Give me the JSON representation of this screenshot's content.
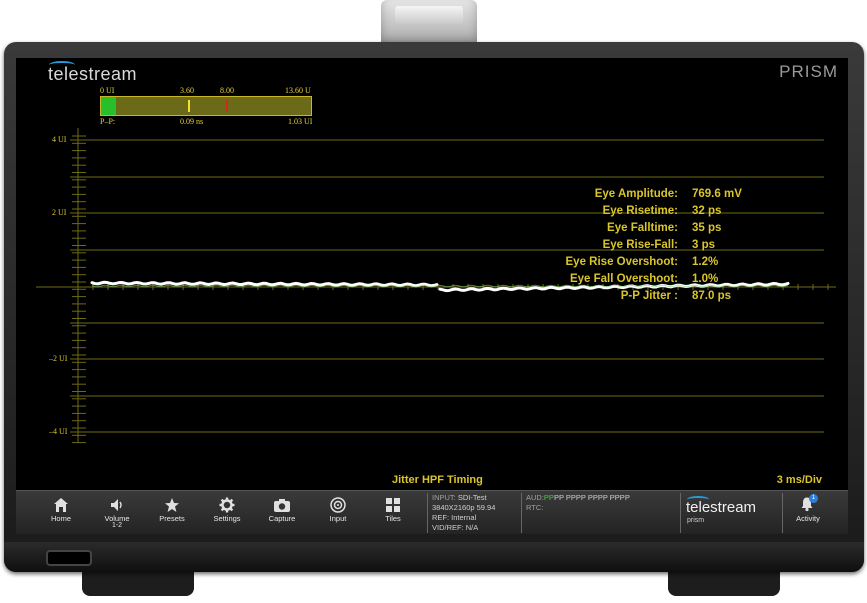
{
  "device": {
    "brand": "telestream",
    "model_title": "PRISM"
  },
  "meter": {
    "top_labels": [
      "0 UI",
      "3.60",
      "8.00",
      "13.60 U"
    ],
    "bottom_left": "P–P:",
    "bottom_mid": "0.09 ns",
    "bottom_right": "1.03 UI",
    "fill_fraction": 0.07,
    "colors": {
      "fill": "#27c02b",
      "bar": "#6b6a18",
      "marker_yellow": "#f4e22a",
      "marker_red": "#d12a1a"
    }
  },
  "y_axis_labels": [
    "4 UI",
    "2 UI",
    "–2 UI",
    "–4 UI"
  ],
  "measurements": [
    {
      "key": "Eye Amplitude:",
      "value": "769.6 mV"
    },
    {
      "key": "Eye Risetime:",
      "value": "32 ps"
    },
    {
      "key": "Eye Falltime:",
      "value": "35 ps"
    },
    {
      "key": "Eye Rise-Fall:",
      "value": "3 ps"
    },
    {
      "key": "Eye Rise Overshoot:",
      "value": "1.2%"
    },
    {
      "key": "Eye Fall Overshoot:",
      "value": "1.0%"
    },
    {
      "key": "P-P Jitter :",
      "value": "87.0 ps"
    }
  ],
  "status": {
    "jitter_hpf": "Jitter HPF Timing",
    "timebase": "3 ms/Div"
  },
  "toolbar": {
    "buttons": [
      {
        "label": "Home",
        "icon": "home-icon"
      },
      {
        "label": "Volume",
        "sub": "1-2",
        "icon": "speaker-icon"
      },
      {
        "label": "Presets",
        "icon": "star-icon"
      },
      {
        "label": "Settings",
        "icon": "gear-icon"
      },
      {
        "label": "Capture",
        "icon": "camera-icon"
      },
      {
        "label": "Input",
        "icon": "input-icon"
      },
      {
        "label": "Tiles",
        "icon": "tiles-icon"
      }
    ],
    "input_info": {
      "input_key": "INPUT:",
      "input_value": "SDI-Test",
      "format": "3840X2160p 59.94",
      "ref": "REF: Internal",
      "vidref": "VID/REF: N/A"
    },
    "audio_info": {
      "aud_key": "AUD:",
      "aud_value_green": "PP",
      "aud_value": "PP PPPP PPPP PPPP",
      "rtc_key": "RTC:"
    },
    "brand": "telestream",
    "brand_sub": "prism",
    "activity_label": "Activity",
    "activity_count": "1",
    "colors": {
      "accent": "#2a9ad6",
      "badge": "#2a7fe0",
      "audio_green": "#3fd13f"
    }
  }
}
